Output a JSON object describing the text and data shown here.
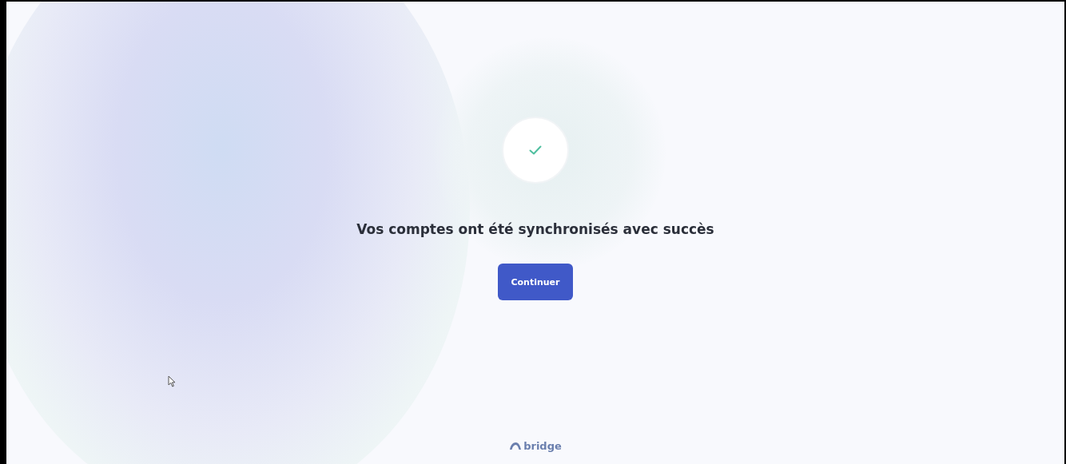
{
  "message": "Vos comptes ont été synchronisés avec succès",
  "button": {
    "label": "Continuer"
  },
  "footer": {
    "logo_text": "bridge"
  }
}
